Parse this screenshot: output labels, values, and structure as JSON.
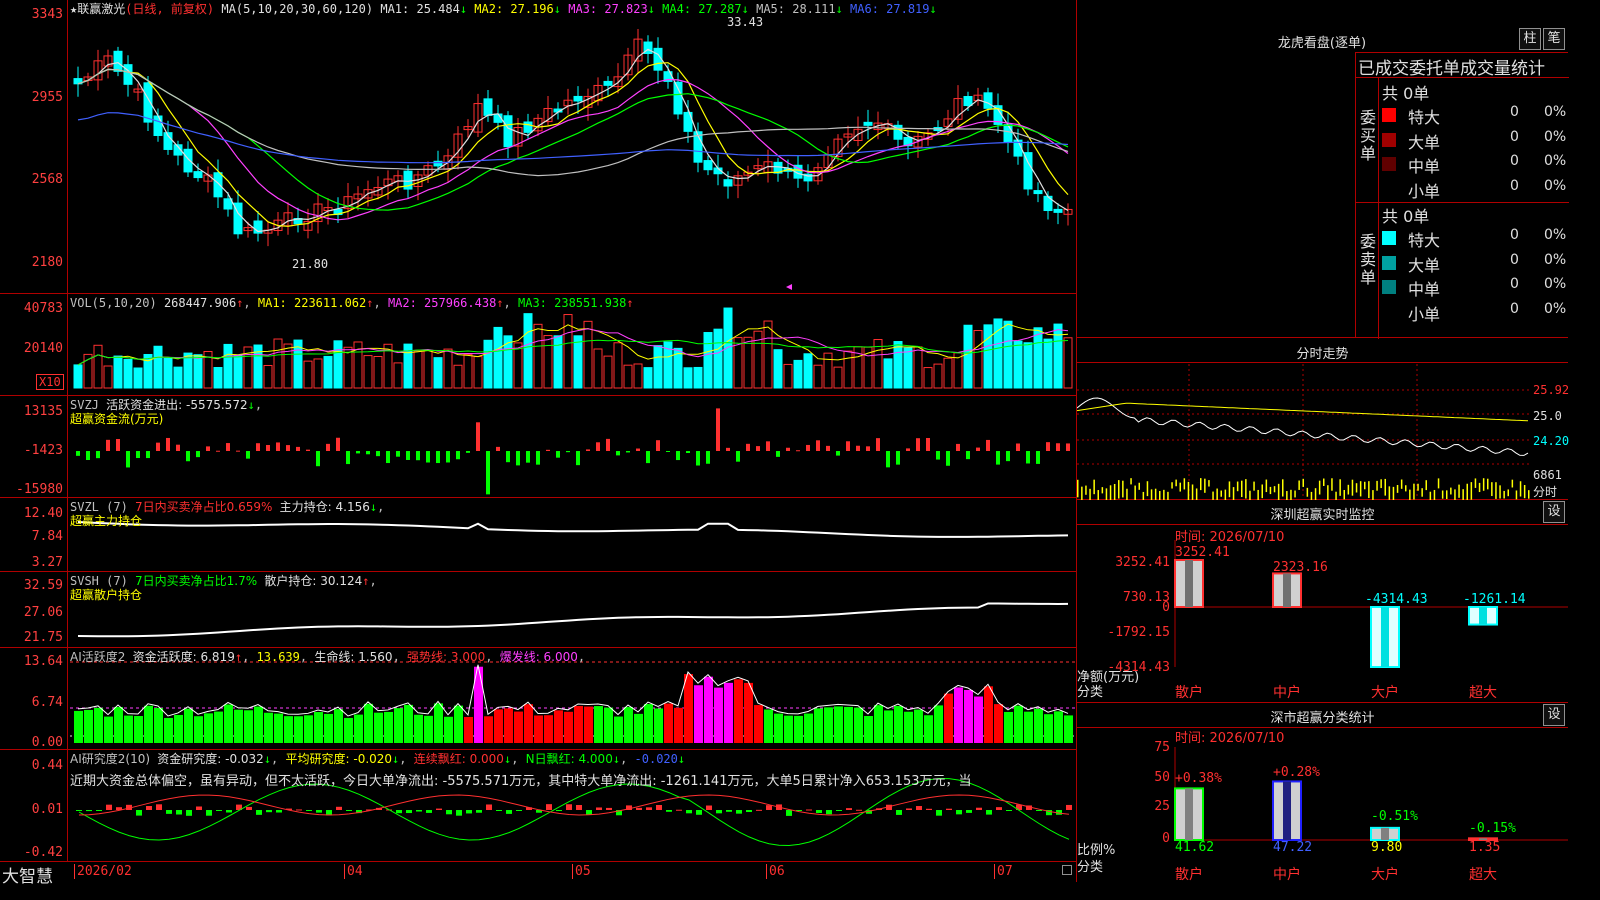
{
  "stock": {
    "star": "★",
    "name": "联赢激光",
    "mode": "(日线, 前复权)",
    "ma_spec": "MA(5,10,20,30,60,120)"
  },
  "ma_values": [
    {
      "label": "MA1: 25.484",
      "arrow": "↓",
      "color": "#e0e0e0"
    },
    {
      "label": "MA2: 27.196",
      "arrow": "↓",
      "color": "#ffff00"
    },
    {
      "label": "MA3: 27.823",
      "arrow": "↓",
      "color": "#ff40ff"
    },
    {
      "label": "MA4: 27.287",
      "arrow": "↓",
      "color": "#00ff00"
    },
    {
      "label": "MA5: 28.111",
      "arrow": "↓",
      "color": "#c0c0c0"
    },
    {
      "label": "MA6: 27.819",
      "arrow": "↓",
      "color": "#4060ff"
    }
  ],
  "price_axis": [
    "3343",
    "2955",
    "2568",
    "2180"
  ],
  "price_annotations": {
    "high": "33.43",
    "low": "21.80"
  },
  "vol": {
    "title": "VOL(5,10,20)",
    "value": "268447.906",
    "ma1": "MA1: 223611.062",
    "ma2": "MA2: 257966.438",
    "ma3": "MA3: 238551.938",
    "axis": [
      "40783",
      "20140"
    ],
    "unit": "X10"
  },
  "svzj": {
    "title": "SVZJ",
    "text": "活跃资金进出: -5575.572",
    "sub": "超赢资金流(万元)",
    "axis": [
      "13135",
      "-1423",
      "-15980"
    ]
  },
  "svzl": {
    "title": "SVZL (7)",
    "text1": "7日内买卖净占比0.659%",
    "text2": "主力持仓: 4.156",
    "sub": "超赢主力持仓",
    "axis": [
      "12.40",
      "7.84",
      "3.27"
    ]
  },
  "svsh": {
    "title": "SVSH (7)",
    "text1": "7日内买卖净占比1.7%",
    "text2": "散户持仓: 30.124",
    "sub": "超赢散户持仓",
    "axis": [
      "32.59",
      "27.06",
      "21.75"
    ]
  },
  "ai1": {
    "title": "AI活跃度2",
    "t1": "资金活跃度: 6.819",
    "t2": "13.639",
    "t3": "生命线: 1.560",
    "t4": "强势线: 3.000",
    "t5": "爆发线: 6.000",
    "axis": [
      "13.64",
      "6.74",
      "0.00"
    ]
  },
  "ai2": {
    "title": "AI研究度2(10)",
    "t1": "资金研究度: -0.032",
    "t2": "平均研究度: -0.020",
    "t3": "连续飘红: 0.000",
    "t4": "N日飘红: 4.000",
    "t5": "-0.020",
    "comment": "近期大资金总体偏空，虽有异动，但不太活跃，今日大单净流出: -5575.571万元，其中特大单净流出: -1261.141万元，大单5日累计净入653.153万元，当",
    "axis": [
      "0.44",
      "0.01",
      "-0.42"
    ]
  },
  "date_axis": [
    "2026/02",
    "04",
    "05",
    "06",
    "07"
  ],
  "brand": "大智慧",
  "lhb": {
    "title": "龙虎看盘(逐单)",
    "btn1": "柱",
    "btn2": "笔",
    "header": "已成交委托单成交量统计",
    "buy": {
      "side": "委买单",
      "total": "共 0单",
      "rows": [
        {
          "name": "特大",
          "val": "0",
          "pct": "0%",
          "color": "#ff0000"
        },
        {
          "name": "大单",
          "val": "0",
          "pct": "0%",
          "color": "#a00000"
        },
        {
          "name": "中单",
          "val": "0",
          "pct": "0%",
          "color": "#600000"
        },
        {
          "name": "小单",
          "val": "0",
          "pct": "0%",
          "color": ""
        }
      ]
    },
    "sell": {
      "side": "委卖单",
      "total": "共 0单",
      "rows": [
        {
          "name": "特大",
          "val": "0",
          "pct": "0%",
          "color": "#00ffff"
        },
        {
          "name": "大单",
          "val": "0",
          "pct": "0%",
          "color": "#00a0a0"
        },
        {
          "name": "中单",
          "val": "0",
          "pct": "0%",
          "color": "#008080"
        },
        {
          "name": "小单",
          "val": "0",
          "pct": "0%",
          "color": ""
        }
      ]
    }
  },
  "fenshi": {
    "title": "分时走势",
    "axis": [
      "25.92",
      "25.0",
      "24.20",
      "6861"
    ],
    "vol_label": "分时"
  },
  "monitor": {
    "title": "深圳超赢实时监控",
    "date": "时间: 2026/07/10",
    "btn": "设",
    "axis": [
      "3252.41",
      "730.13",
      "0",
      "-1792.15",
      "-4314.43"
    ],
    "ylabel": "净额(万元)",
    "xlabel": "分类",
    "cats": [
      "散户",
      "中户",
      "大户",
      "超大"
    ],
    "values": [
      "3252.41",
      "2323.16",
      "-4314.43",
      "-1261.14"
    ]
  },
  "classify": {
    "title": "深市超赢分类统计",
    "date": "时间: 2026/07/10",
    "btn": "设",
    "axis": [
      "75",
      "50",
      "25",
      "0"
    ],
    "ylabel": "比例%",
    "xlabel": "分类",
    "cats": [
      "散户",
      "中户",
      "大户",
      "超大"
    ],
    "pcts": [
      "41.62",
      "47.22",
      "9.80",
      "1.35"
    ],
    "changes": [
      "+0.38%",
      "+0.28%",
      "-0.51%",
      "-0.15%"
    ]
  }
}
